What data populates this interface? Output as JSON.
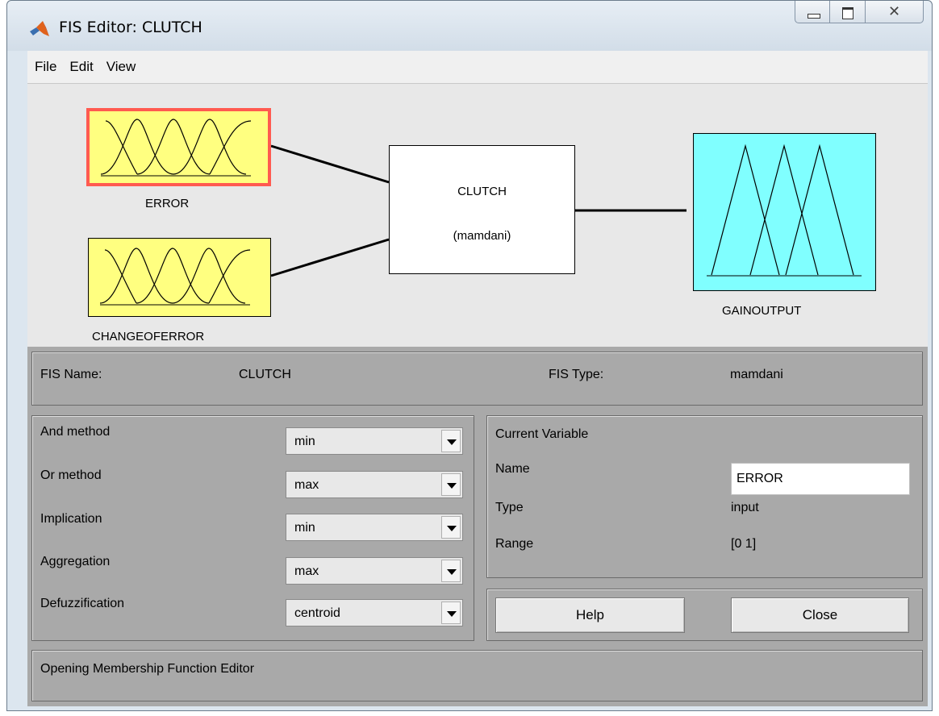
{
  "window": {
    "title": "FIS Editor: CLUTCH"
  },
  "menu": [
    "File",
    "Edit",
    "View"
  ],
  "diagram": {
    "inputs": [
      {
        "label": "ERROR",
        "selected": true,
        "color": "#ffff80"
      },
      {
        "label": "CHANGEOFERROR",
        "selected": false,
        "color": "#ffff80"
      }
    ],
    "system": {
      "name": "CLUTCH",
      "type": "(mamdani)"
    },
    "output": {
      "label": "GAINOUTPUT",
      "color": "#80ffff"
    },
    "selection_color": "#ff5a50"
  },
  "info": {
    "fis_name_label": "FIS Name:",
    "fis_name_value": "CLUTCH",
    "fis_type_label": "FIS Type:",
    "fis_type_value": "mamdani"
  },
  "methods": [
    {
      "label": "And method",
      "value": "min"
    },
    {
      "label": "Or method",
      "value": "max"
    },
    {
      "label": "Implication",
      "value": "min"
    },
    {
      "label": "Aggregation",
      "value": "max"
    },
    {
      "label": "Defuzzification",
      "value": "centroid"
    }
  ],
  "current_variable": {
    "title": "Current Variable",
    "name_label": "Name",
    "name_value": "ERROR",
    "type_label": "Type",
    "type_value": "input",
    "range_label": "Range",
    "range_value": "[0 1]"
  },
  "buttons": {
    "help": "Help",
    "close": "Close"
  },
  "status": "Opening Membership Function Editor"
}
